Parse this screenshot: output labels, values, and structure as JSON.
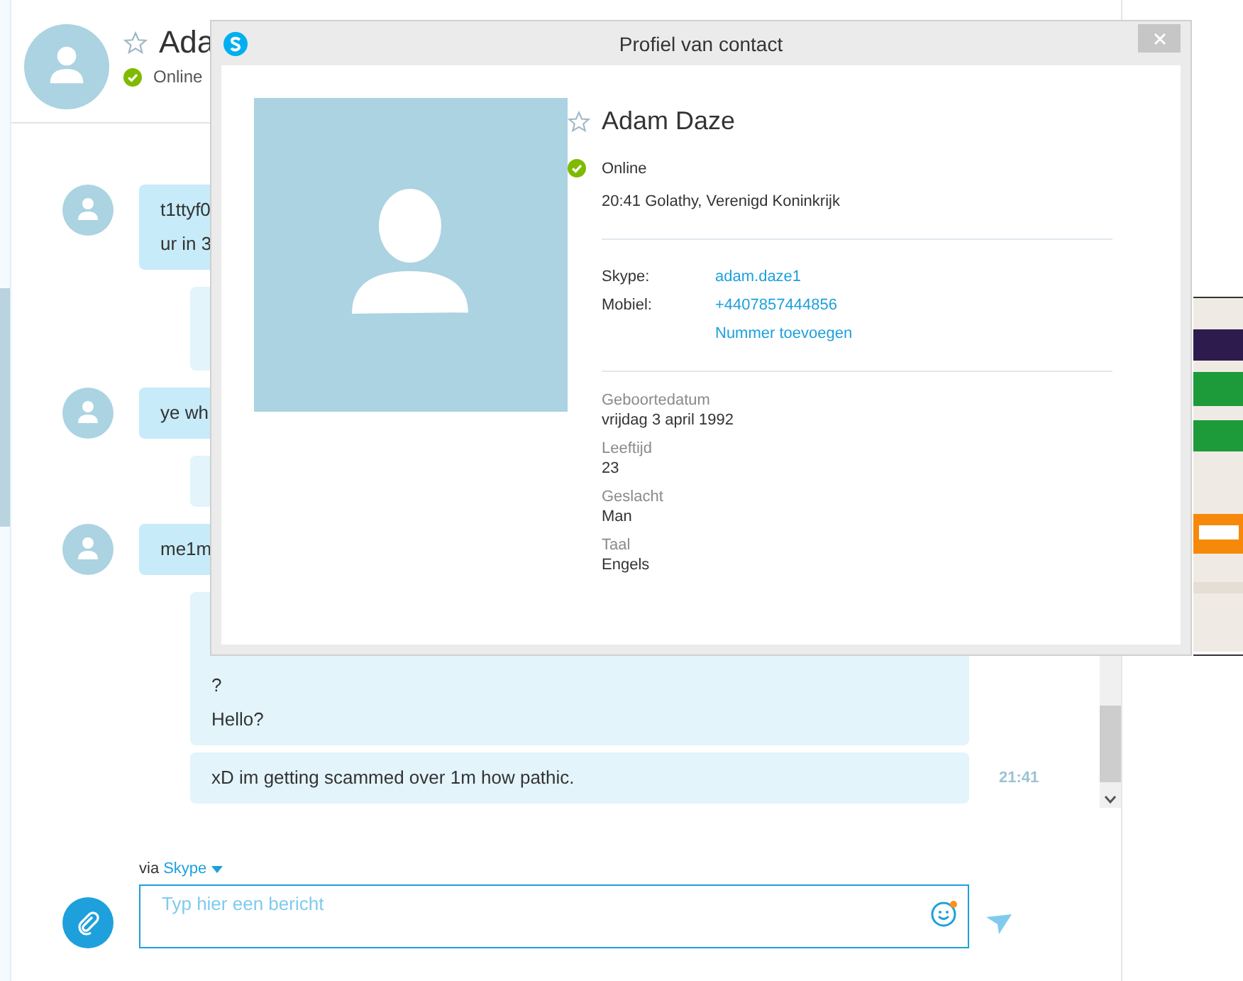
{
  "conversation": {
    "name": "Ada",
    "starred": false,
    "online": true,
    "status": "Online"
  },
  "messages": [
    {
      "kind": "incoming",
      "lines": [
        "t1ttyf0",
        "ur in 3"
      ]
    },
    {
      "kind": "outgoing"
    },
    {
      "kind": "incoming",
      "lines": [
        "ye wh"
      ]
    },
    {
      "kind": "outgoing"
    },
    {
      "kind": "incoming",
      "lines": [
        "me1m"
      ]
    },
    {
      "kind": "outgoing",
      "lines": [
        "?",
        "Hello?"
      ]
    },
    {
      "kind": "outgoing",
      "lines": [
        "xD im getting scammed over 1m how pathic."
      ],
      "time": "21:41"
    }
  ],
  "composer": {
    "via": "via",
    "service": "Skype",
    "placeholder": "Typ hier een bericht"
  },
  "dialog": {
    "title": "Profiel van contact",
    "contact": {
      "name": "Adam Daze",
      "starred": false,
      "online": true,
      "status": "Online",
      "local_time": "20:41 Golathy, Verenigd Koninkrijk",
      "numbers": [
        {
          "label": "Skype:",
          "value": "adam.daze1"
        },
        {
          "label": "Mobiel:",
          "value": "+4407857444856"
        }
      ],
      "add_number": "Nummer toevoegen",
      "details": [
        {
          "label": "Geboortedatum",
          "value": "vrijdag 3 april 1992"
        },
        {
          "label": "Leeftijd",
          "value": "23"
        },
        {
          "label": "Geslacht",
          "value": "Man"
        },
        {
          "label": "Taal",
          "value": "Engels"
        }
      ]
    }
  }
}
